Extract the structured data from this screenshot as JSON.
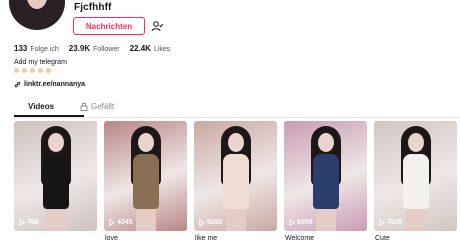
{
  "profile": {
    "username": "Fjcfhhff",
    "message_label": "Nachrichten",
    "bio": "Add my telegram",
    "link": "linktr.ee/nannanya"
  },
  "stats": [
    {
      "value": "133",
      "label": "Folge ich"
    },
    {
      "value": "23.9K",
      "label": "Follower"
    },
    {
      "value": "22.4K",
      "label": "Likes"
    }
  ],
  "tabs": {
    "videos": "Videos",
    "liked": "Gefällt"
  },
  "videos": [
    {
      "plays": "766",
      "caption": "",
      "bg": "#cfc2bf",
      "outfit": "#151515"
    },
    {
      "plays": "4045",
      "caption": "love",
      "bg": "#b98686",
      "outfit": "#8b6f55"
    },
    {
      "plays": "9290",
      "caption": "like me",
      "bg": "#c9a9a1",
      "outfit": "#f1ddd4"
    },
    {
      "plays": "8059",
      "caption": "Welcome",
      "bg": "#c89cb4",
      "outfit": "#2b3d6b"
    },
    {
      "plays": "7638",
      "caption": "Cute",
      "bg": "#d2c6c1",
      "outfit": "#f3f1ee"
    }
  ],
  "colors": {
    "accent": "#fe2c55",
    "text": "#161823"
  }
}
